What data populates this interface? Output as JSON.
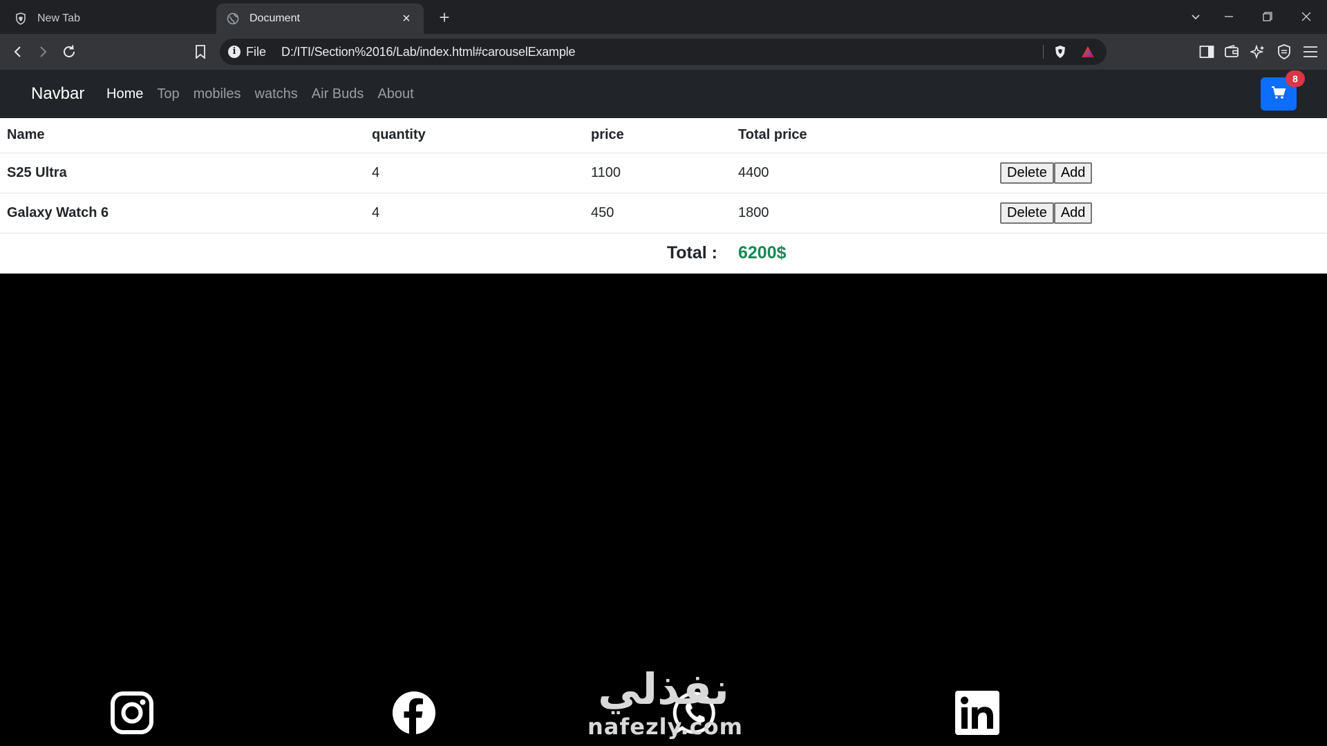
{
  "browser": {
    "tabs": [
      {
        "title": "New Tab",
        "active": false
      },
      {
        "title": "Document",
        "active": true
      }
    ],
    "address": {
      "scheme_label": "File",
      "url": "D:/ITI/Section%2016/Lab/index.html#carouselExample"
    }
  },
  "navbar": {
    "brand": "Navbar",
    "links": [
      "Home",
      "Top",
      "mobiles",
      "watchs",
      "Air Buds",
      "About"
    ],
    "active_link": "Home",
    "cart_count": "8"
  },
  "cart_table": {
    "headers": [
      "Name",
      "quantity",
      "price",
      "Total price"
    ],
    "rows": [
      {
        "name": "S25 Ultra",
        "quantity": "4",
        "price": "1100",
        "total": "4400"
      },
      {
        "name": "Galaxy Watch 6",
        "quantity": "4",
        "price": "450",
        "total": "1800"
      }
    ],
    "delete_label": "Delete",
    "add_label": "Add",
    "total_label": "Total :",
    "total_value": "6200$"
  },
  "footer": {
    "social_icons": [
      "instagram-icon",
      "facebook-icon",
      "whatsapp-icon",
      "linkedin-icon"
    ]
  },
  "watermark": {
    "arabic": "نفذلي",
    "latin": "nafezly.com"
  },
  "colors": {
    "navbar_bg": "#212529",
    "cart_button": "#0d6efd",
    "badge": "#dc3545",
    "total_value": "#198754"
  }
}
